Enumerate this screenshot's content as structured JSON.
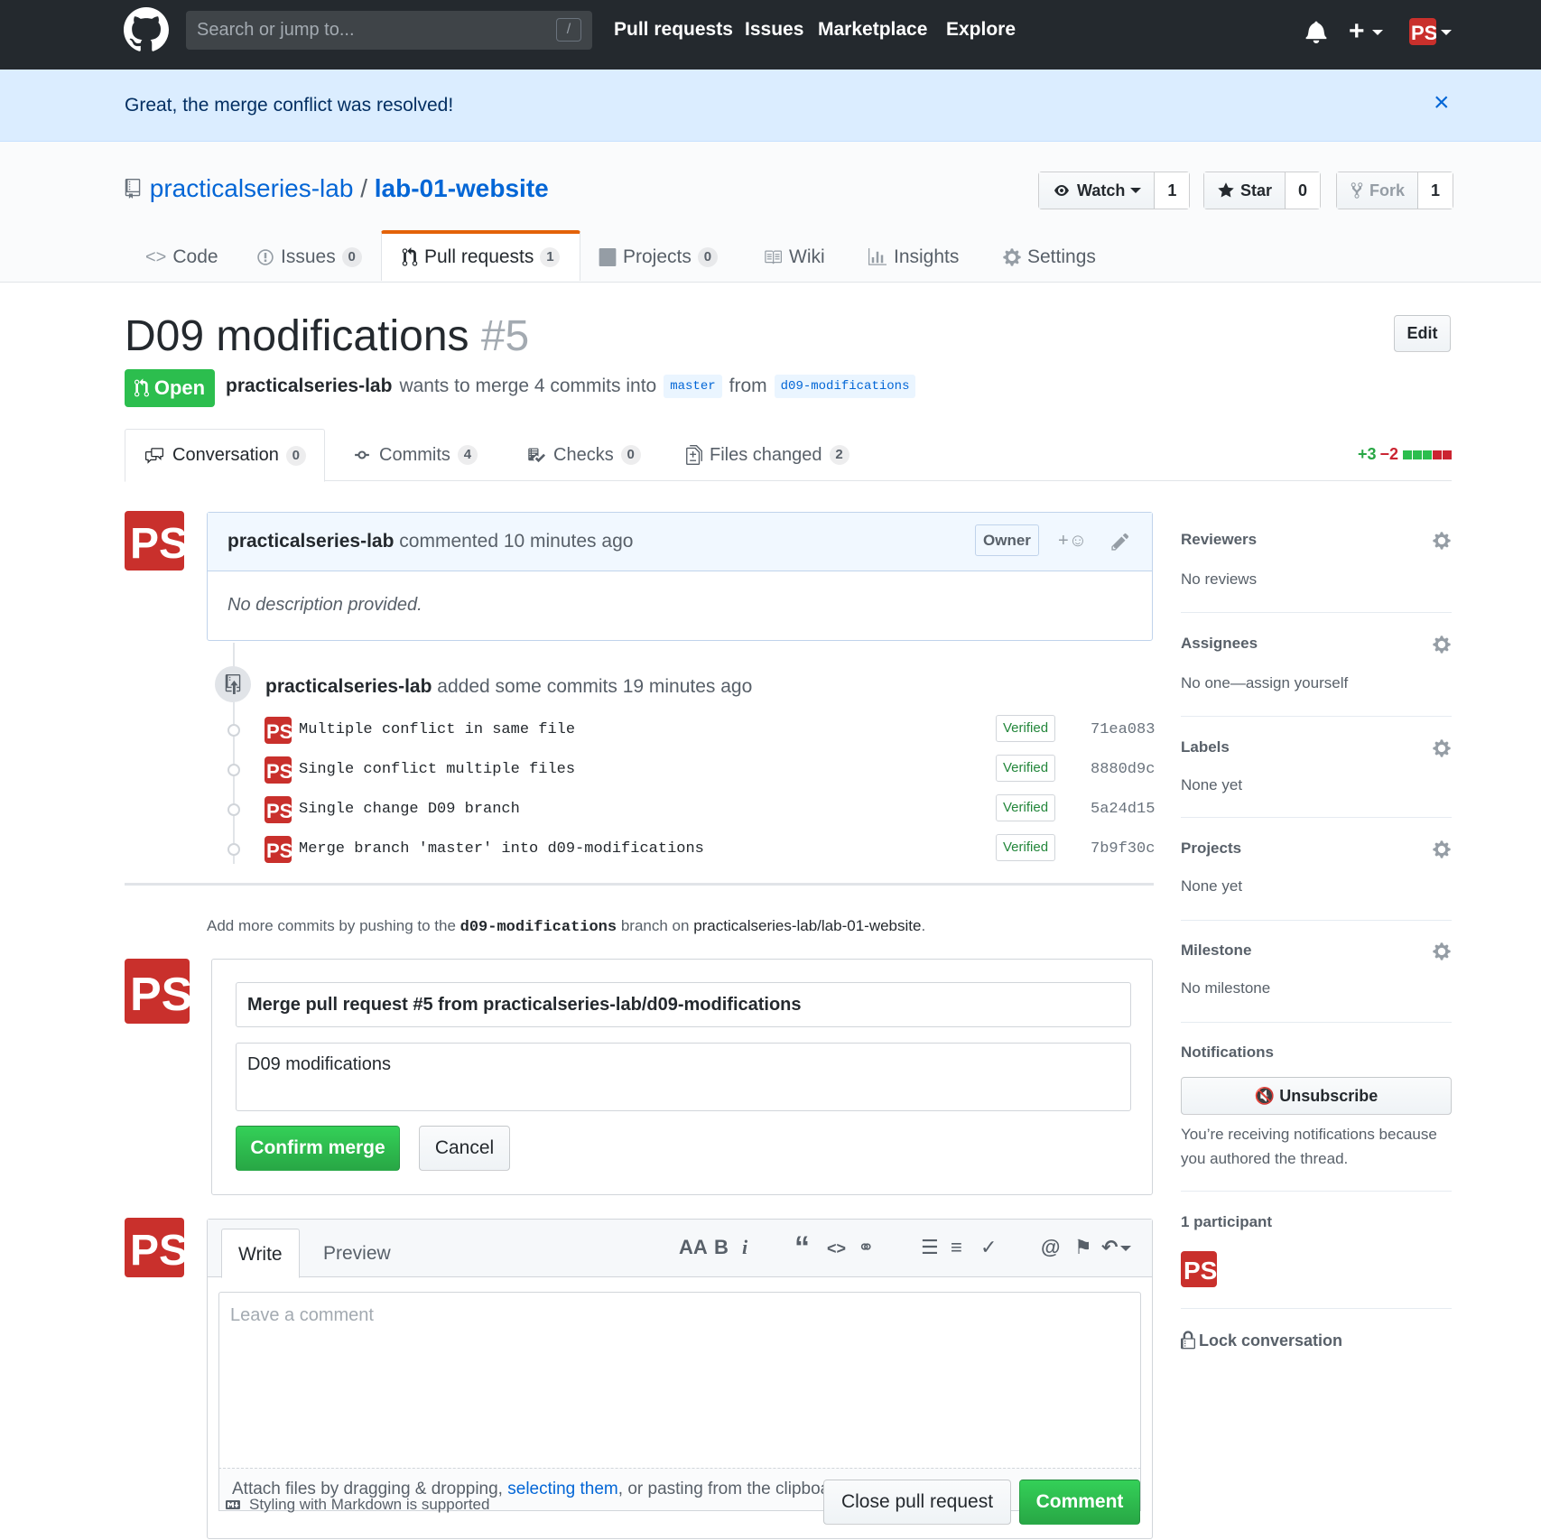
{
  "header": {
    "search_placeholder": "Search or jump to...",
    "search_key": "/",
    "nav": [
      "Pull requests",
      "Issues",
      "Marketplace",
      "Explore"
    ],
    "icons": [
      "github-logo",
      "bell-icon",
      "plus-icon",
      "avatar"
    ]
  },
  "flash": {
    "message": "Great, the merge conflict was resolved!",
    "close": "×"
  },
  "repo": {
    "owner": "practicalseries-lab",
    "separator": "/",
    "name": "lab-01-website",
    "watch": {
      "label": "Watch",
      "count": "1"
    },
    "star": {
      "label": "Star",
      "count": "0"
    },
    "fork": {
      "label": "Fork",
      "count": "1"
    },
    "tabs": [
      {
        "label": "Code",
        "count": ""
      },
      {
        "label": "Issues",
        "count": "0"
      },
      {
        "label": "Pull requests",
        "count": "1"
      },
      {
        "label": "Projects",
        "count": "0"
      },
      {
        "label": "Wiki",
        "count": ""
      },
      {
        "label": "Insights",
        "count": ""
      },
      {
        "label": "Settings",
        "count": ""
      }
    ]
  },
  "pr": {
    "title": "D09 modifications",
    "number": "#5",
    "edit": "Edit",
    "state": "Open",
    "author": "practicalseries-lab",
    "wants": "wants to merge 4 commits into",
    "base": "master",
    "from": "from",
    "head": "d09-modifications",
    "tabs": [
      {
        "label": "Conversation",
        "count": "0"
      },
      {
        "label": "Commits",
        "count": "4"
      },
      {
        "label": "Checks",
        "count": "0"
      },
      {
        "label": "Files changed",
        "count": "2"
      }
    ],
    "additions": "+3",
    "deletions": "−2",
    "diffstat_blocks": [
      "green",
      "green",
      "green",
      "red",
      "red"
    ]
  },
  "comment": {
    "author": "practicalseries-lab",
    "action": "commented 10 minutes ago",
    "badge": "Owner",
    "reaction": "+",
    "body": "No description provided."
  },
  "push": {
    "author": "practicalseries-lab",
    "text": "added some commits 19 minutes ago",
    "commits": [
      {
        "message": "Multiple conflict in same file",
        "verified": "Verified",
        "sha": "71ea083"
      },
      {
        "message": "Single conflict multiple files",
        "verified": "Verified",
        "sha": "8880d9c"
      },
      {
        "message": "Single change D09 branch",
        "verified": "Verified",
        "sha": "5a24d15"
      },
      {
        "message": "Merge branch 'master' into d09-modifications",
        "verified": "Verified",
        "sha": "7b9f30c"
      }
    ]
  },
  "hint": {
    "prefix": "Add more commits by pushing to the",
    "branch": "d09-modifications",
    "mid": "branch on",
    "repo": "practicalseries-lab/lab-01-website",
    "suffix": "."
  },
  "merge": {
    "title_value": "Merge pull request #5 from practicalseries-lab/d09-modifications",
    "body_value": "D09 modifications",
    "confirm": "Confirm merge",
    "cancel": "Cancel"
  },
  "writer": {
    "tab_write": "Write",
    "tab_preview": "Preview",
    "placeholder": "Leave a comment",
    "attach_prefix": "Attach files by dragging & dropping, ",
    "attach_link": "selecting them",
    "attach_suffix": ", or pasting from the clipboard.",
    "markdown_note": "Styling with Markdown is supported",
    "close_pr": "Close pull request",
    "comment": "Comment",
    "toolbar": [
      "AA",
      "B",
      "i",
      "“",
      "<>",
      "link-icon",
      "ul-icon",
      "ol-icon",
      "tasklist-icon",
      "@",
      "bookmark-icon",
      "reply-icon"
    ]
  },
  "sidebar": {
    "reviewers": {
      "title": "Reviewers",
      "value": "No reviews"
    },
    "assignees": {
      "title": "Assignees",
      "value": "No one—assign yourself"
    },
    "labels": {
      "title": "Labels",
      "value": "None yet"
    },
    "projects": {
      "title": "Projects",
      "value": "None yet"
    },
    "milestone": {
      "title": "Milestone",
      "value": "No milestone"
    },
    "notifications": {
      "title": "Notifications",
      "button": "Unsubscribe",
      "reason": "You’re receiving notifications because you authored the thread."
    },
    "participants": {
      "title": "1 participant"
    },
    "lock": "Lock conversation"
  },
  "colors": {
    "header": "#24292e",
    "flash": "#dbedff",
    "green": "#2cbe4e",
    "link": "#0366d6",
    "avatar": "#c9302c",
    "tab_accent": "#e36209"
  }
}
